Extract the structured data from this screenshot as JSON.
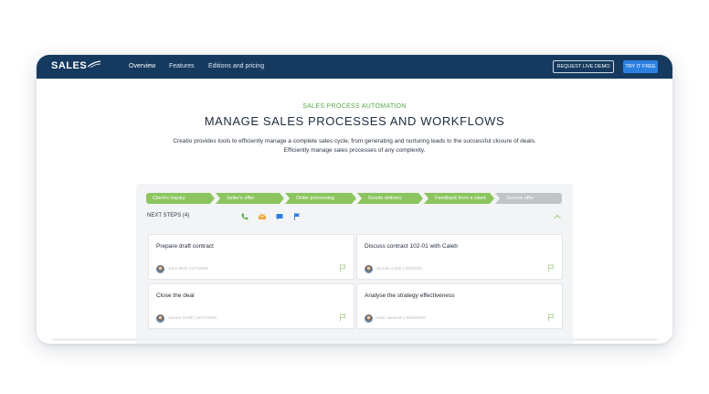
{
  "nav": {
    "logo": "SALES",
    "links": [
      "Overview",
      "Features",
      "Editions and pricing"
    ],
    "demo_button": "REQUEST LIVE DEMO",
    "try_button": "TRY IT FREE"
  },
  "hero": {
    "eyebrow": "SALES PROCESS AUTOMATION",
    "title": "MANAGE SALES PROCESSES AND WORKFLOWS",
    "description_line1": "Creatio provides tools to efficiently manage a complete sales cycle, from generating and nurturing leads to the successful closure of deals.",
    "description_line2": "Efficiently manage sales processes of any complexity."
  },
  "pipeline": {
    "stages": [
      "Client's inquiry",
      "Seller's offer",
      "Order processing",
      "Goods delivery",
      "Feedback from a client",
      "Service offer"
    ],
    "next_steps_label": "NEXT STEPS (4)",
    "activity_icons": [
      "phone-icon",
      "email-icon",
      "chat-icon",
      "flag-icon"
    ],
    "colors": {
      "stage_done": "#8cc55f",
      "stage_pending": "#bfc4c8",
      "nav": "#163a5f",
      "accent_blue": "#2d7fe0"
    },
    "tasks": [
      {
        "title": "Prepare draft contract",
        "meta": "John Best | 6/7/2020"
      },
      {
        "title": "Discuss contract 102-01 with Caleb",
        "meta": "Symon Clark | 6/6/2020"
      },
      {
        "title": "Close the deal",
        "meta": "James Smith | 5/27/2020"
      },
      {
        "title": "Analyse the strategy effectiveness",
        "meta": "Kate Jackson | 5/26/2020"
      }
    ]
  }
}
